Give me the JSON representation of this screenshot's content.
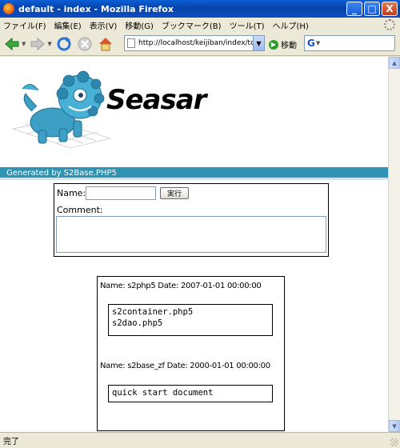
{
  "window": {
    "title": "default - index - Mozilla Firefox",
    "buttons": {
      "minimize": "_",
      "maximize": "□",
      "close": "X"
    }
  },
  "menu": [
    "ファイル(F)",
    "編集(E)",
    "表示(V)",
    "移動(G)",
    "ブックマーク(B)",
    "ツール(T)",
    "ヘルプ(H)"
  ],
  "nav": {
    "url": "http://localhost/keijiban/index/top",
    "go_label": "移動",
    "search_value": ""
  },
  "page": {
    "banner_word": "Seasar",
    "generated_by": "Generated by S2Base.PHP5",
    "form": {
      "name_label": "Name:",
      "name_value": "",
      "submit_label": "実行",
      "comment_label": "Comment:",
      "comment_value": ""
    },
    "posts": [
      {
        "header": "Name: s2php5  Date: 2007-01-01 00:00:00",
        "lines": [
          "s2container.php5",
          "s2dao.php5"
        ]
      },
      {
        "header": "Name: s2base_zf  Date: 2000-01-01 00:00:00",
        "lines": [
          "quick start document"
        ]
      }
    ]
  },
  "status": {
    "text": "完了"
  },
  "colors": {
    "titlebar": "#0a4fc4",
    "generated_bar": "#2f93b4",
    "chrome": "#ece9d8"
  }
}
